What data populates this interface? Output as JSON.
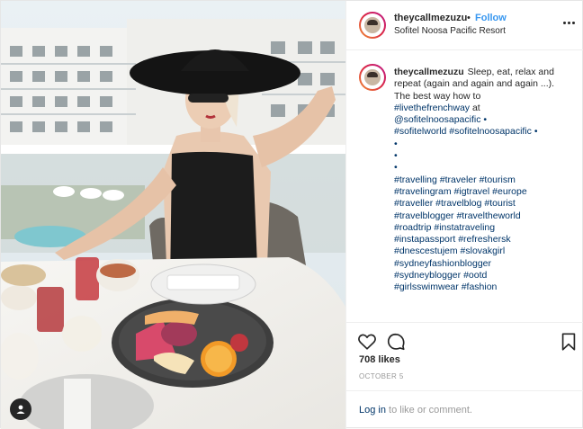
{
  "post": {
    "username": "theycallmezuzu",
    "follow_label": "Follow",
    "separator": "•",
    "location": "Sofitel Noosa Pacific Resort"
  },
  "caption": {
    "username": "theycallmezuzu",
    "text_lines": [
      "Sleep, eat, relax and",
      "repeat (again and again and again ...).",
      "The best way how to"
    ],
    "tag_lines": [
      [
        "#livethefrenchway",
        "at"
      ],
      [
        "@sofitelnoosapacific",
        "•"
      ],
      [
        "#sofitelworld",
        "#sofitelnoosapacific",
        "•"
      ],
      [
        "•"
      ],
      [
        "•"
      ],
      [
        "•"
      ],
      [
        "#travelling",
        "#traveler",
        "#tourism"
      ],
      [
        "#travelingram",
        "#igtravel",
        "#europe"
      ],
      [
        "#traveller",
        "#travelblog",
        "#tourist"
      ],
      [
        "#travelblogger",
        "#traveltheworld"
      ],
      [
        "#roadtrip",
        "#instatraveling"
      ],
      [
        "#instapassport",
        "#refreshersk"
      ],
      [
        "#dnescestujem",
        "#slovakgirl"
      ],
      [
        "#sydneyfashionblogger"
      ],
      [
        "#sydneyblogger",
        "#ootd"
      ],
      [
        "#girlsswimwear",
        "#fashion"
      ]
    ]
  },
  "icons": {
    "more": "more-options-icon",
    "like": "heart-icon",
    "comment": "comment-icon",
    "save": "bookmark-icon",
    "tagged": "user-tag-icon"
  },
  "stats": {
    "likes": "708 likes",
    "date": "OCTOBER 5"
  },
  "login": {
    "link": "Log in",
    "rest": " to like or comment."
  },
  "colors": {
    "link": "#003569",
    "follow": "#3897f0",
    "text": "#262626",
    "muted": "#999999"
  }
}
